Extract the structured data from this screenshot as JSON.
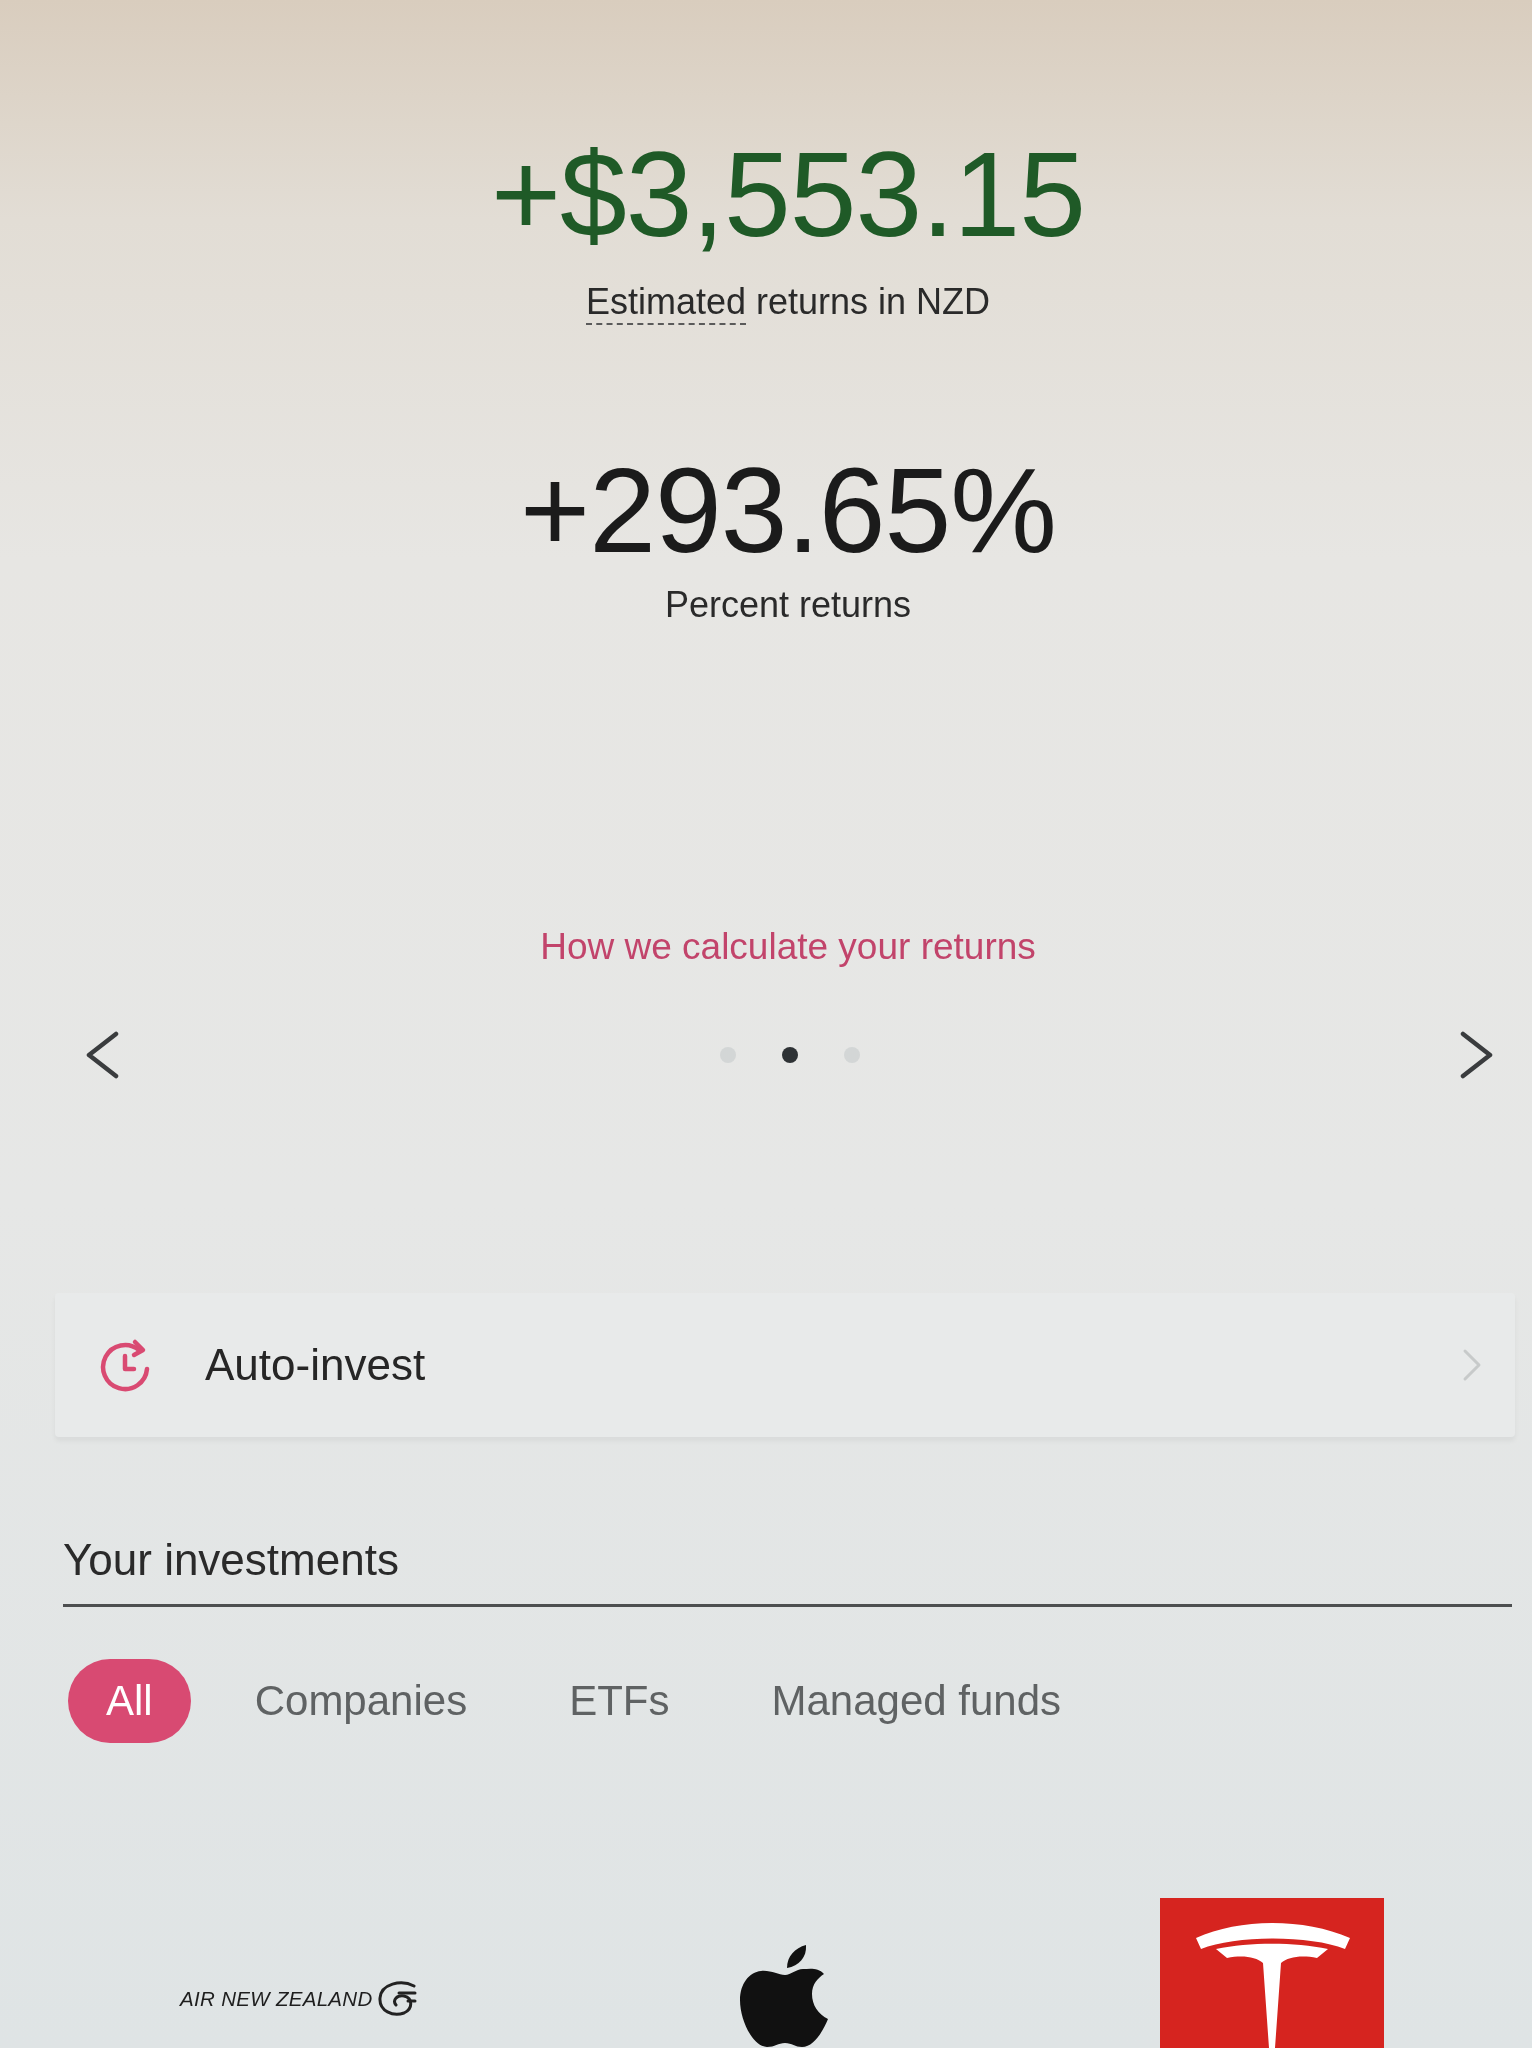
{
  "returns": {
    "amount": "+$3,553.15",
    "caption": {
      "term": "Estimated",
      "text": "returns in NZD"
    }
  },
  "percent": {
    "value": "+293.65%",
    "caption": "Percent returns"
  },
  "link": "How we calculate your returns",
  "carousel": {
    "dots": [
      {
        "selected": false
      },
      {
        "selected": true
      },
      {
        "selected": false
      }
    ]
  },
  "auto_invest": {
    "label": "Auto-invest"
  },
  "investments": {
    "title": "Your investments",
    "tabs": [
      {
        "label": "All",
        "selected": true
      },
      {
        "label": "Companies",
        "selected": false
      },
      {
        "label": "ETFs",
        "selected": false
      },
      {
        "label": "Managed funds",
        "selected": false
      }
    ],
    "holdings": [
      {
        "kind": "wordmark",
        "name": "AIR NEW ZEALAND"
      },
      {
        "kind": "apple"
      },
      {
        "kind": "emblem"
      }
    ]
  }
}
